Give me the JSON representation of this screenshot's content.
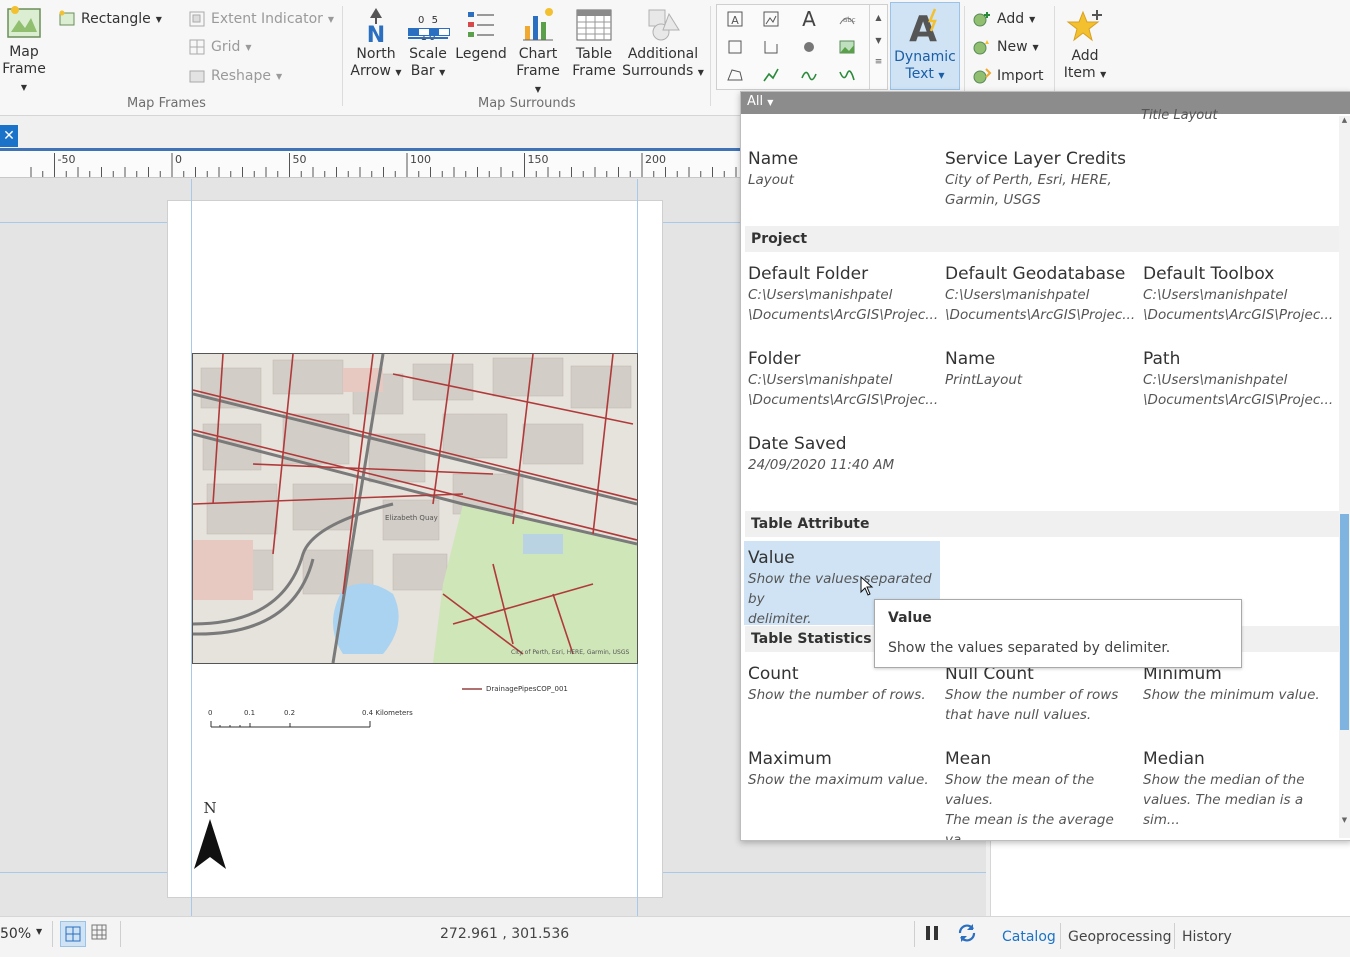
{
  "ribbon": {
    "map_frame": {
      "line1": "Map",
      "line2": "Frame"
    },
    "rectangle": "Rectangle",
    "extent_indicator": "Extent Indicator",
    "grid": "Grid",
    "reshape": "Reshape",
    "map_frames_group": "Map Frames",
    "north_arrow": {
      "line1": "North",
      "line2": "Arrow"
    },
    "scale_bar": {
      "line1": "Scale",
      "line2": "Bar"
    },
    "scale_ticks": "0 5 10",
    "legend": "Legend",
    "chart_frame": {
      "line1": "Chart",
      "line2": "Frame"
    },
    "table_frame": {
      "line1": "Table",
      "line2": "Frame"
    },
    "additional_surrounds": {
      "line1": "Additional",
      "line2": "Surrounds"
    },
    "map_surrounds_group": "Map Surrounds",
    "dynamic_text": {
      "line1": "Dynamic",
      "line2": "Text"
    },
    "add": "Add",
    "new": "New",
    "import": "Import",
    "add_item": {
      "line1": "Add",
      "line2": "Item"
    }
  },
  "ruler": {
    "labels": [
      "-50",
      "0",
      "50",
      "100",
      "150",
      "200"
    ]
  },
  "page": {
    "legend_item": "DrainagePipesCOP_001",
    "scale_labels": [
      "0",
      "0.1",
      "0.2",
      "0.4 Kilometers"
    ],
    "north": "N",
    "map_credit": "City of Perth, Esri, HERE, Garmin, USGS",
    "map_label": "Elizabeth Quay"
  },
  "status": {
    "zoom": "50%",
    "coordinates": "272.961 , 301.536"
  },
  "right_tabs": [
    "Catalog",
    "Geoprocessing",
    "History"
  ],
  "dropdown": {
    "filter": "All",
    "partial_header": "Title Layout",
    "top_items": [
      {
        "name": "Name",
        "desc": "Layout"
      },
      {
        "name": "Service Layer Credits",
        "desc": "City of Perth, Esri, HERE,\nGarmin, USGS"
      }
    ],
    "project_header": "Project",
    "project_items": [
      {
        "name": "Default Folder",
        "desc": "C:\\Users\\manishpatel\n\\Documents\\ArcGIS\\Projec..."
      },
      {
        "name": "Default Geodatabase",
        "desc": "C:\\Users\\manishpatel\n\\Documents\\ArcGIS\\Projec..."
      },
      {
        "name": "Default Toolbox",
        "desc": "C:\\Users\\manishpatel\n\\Documents\\ArcGIS\\Projec..."
      },
      {
        "name": "Folder",
        "desc": "C:\\Users\\manishpatel\n\\Documents\\ArcGIS\\Projec..."
      },
      {
        "name": "Name",
        "desc": "PrintLayout"
      },
      {
        "name": "Path",
        "desc": "C:\\Users\\manishpatel\n\\Documents\\ArcGIS\\Projec..."
      },
      {
        "name": "Date Saved",
        "desc": "24/09/2020 11:40 AM"
      }
    ],
    "table_attr_header": "Table Attribute",
    "table_attr_items": [
      {
        "name": "Value",
        "desc": "Show the values separated by\ndelimiter."
      }
    ],
    "table_stats_header": "Table Statistics",
    "table_stats_items": [
      {
        "name": "Count",
        "desc": "Show the number of rows."
      },
      {
        "name": "Null Count",
        "desc": "Show the number of rows\nthat have null values."
      },
      {
        "name": "Minimum",
        "desc": "Show the minimum value."
      },
      {
        "name": "Maximum",
        "desc": "Show the maximum value."
      },
      {
        "name": "Mean",
        "desc": "Show the mean of the values.\nThe mean is the average va..."
      },
      {
        "name": "Median",
        "desc": "Show the median of the\nvalues. The median is a sim..."
      }
    ]
  },
  "tooltip": {
    "title": "Value",
    "text": "Show the values separated by delimiter."
  },
  "colors": {
    "accent": "#1a73c8",
    "selection": "#cfe3f4",
    "road": "#b03a3a",
    "park": "#cfe6b8",
    "water": "#a9d3f0"
  }
}
